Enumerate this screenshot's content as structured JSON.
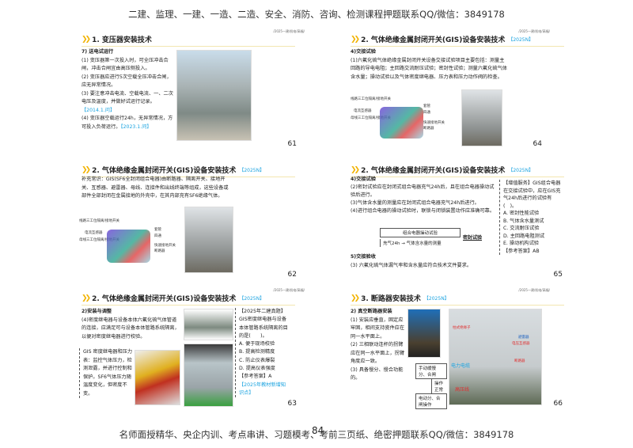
{
  "header": "二建、监理、一建、一造、二造、安全、消防、咨询、检测课程押题联系QQ/微信：3849178",
  "footer": "名师面授精华、央企内训、考点串讲、习题模考、考前三页纸、绝密押题联系QQ/微信：3849178",
  "page_number": "84",
  "crumb": "/2025一建/机电/高福/",
  "slides": [
    {
      "num": "61",
      "title": "1. 变压器安装技术",
      "heading": "7) 送电试运行",
      "lines": [
        "(1) 变压器第一次投入时，可全压冲击合闸，冲击合闸宜由高压侧投入。",
        "(2) 变压器应进行5次空载全压冲击合闸，应无异常情况。",
        "(3) 要注意冲击电流、空载电流、一、二次电压及温度，并做好试运行记录。"
      ],
      "tag1": "【2014.1.问】",
      "line4": "(4) 变压器空载运行24h，无异常情况，方可投入负荷运行。",
      "tag2": "【2023.1.问】"
    },
    {
      "num": "64",
      "title": "2. 气体绝缘金属封闭开关(GIS)设备安装技术",
      "tag": "【2025N】",
      "heading": "4)交接试验",
      "text": "(1)六氟化硫气体绝缘金属封闭开关设备交接试验项目主要包括：测量主回路的导电电阻；主回路交流耐压试验；密封性试验；测量六氟化硫气体含水量；操动试验以及气体密度继电器、压力表和压力动作阀的检查。",
      "labels": [
        "线路三工位隔离/接地开关",
        "电流互感器",
        "母线三工位隔离/接地开关",
        "套管",
        "四通",
        "快速接地开关",
        "断路器"
      ]
    },
    {
      "num": "62",
      "title": "2. 气体绝缘金属封闭开关(GIS)设备安装技术",
      "tag": "【2025N】",
      "text": "补充常识：GIS(SF6全封闭组合电器)由断路器、隔离开关、接地开关、互感器、避雷器、母线、连接件和出线终端等组成，这些设备或部件全部封闭在金属接地的外壳中，在其内部充有SF6绝缘气体。",
      "labels": [
        "线路三工位隔离/接地开关",
        "电流互感器",
        "母线三工位隔离/接地开关",
        "套管",
        "四通",
        "快速接地开关",
        "断路器"
      ]
    },
    {
      "num": "65",
      "title": "2. 气体绝缘金属封闭开关(GIS)设备安装技术",
      "tag": "【2025N】",
      "heading": "4)交接试验",
      "lines": [
        "(2)密封试验应在封闭式组合电器充气24h后，且在组合电器操动试验后进行。",
        "(3)气体含水量的测量应在封闭式组合电器充气24h后进行。",
        "(4)进行组合电器的操动试验时，联锁与闭锁装置动作应准确可靠。"
      ],
      "diagram": {
        "top": "组合电器操动试验",
        "bottom": "充气24h → 气体含水量的测量",
        "result": "密封试验"
      },
      "heading2": "5)交接验收",
      "line5": "(3) 六氟化硫气体漏气率和含水量应符合技术文件要求。",
      "question": "【增值服务】GIS组合电器在交接试验中，应在GIS充气24h后进行的试验有(　)。",
      "options": [
        "A. 密封性能试验",
        "B. 气体含水量测试",
        "C. 交流耐压试验",
        "D. 主回路电阻测试",
        "E. 操动机构试验"
      ],
      "answer": "【参考答案】AB"
    },
    {
      "num": "63",
      "title": "2. 气体绝缘金属封闭开关(GIS)设备安装技术",
      "tag": "【2025N】",
      "heading": "2)安装与调整",
      "text": "(4)密度继电器与设备本体六氟化硫气体管道的连接，应满足可与设备本体管路系统隔离，以便对密度继电器进行校验。",
      "note": "GIS 密度继电器和压力表：监控气体压力，检测泄露，并进行控制和保护。SF6气体压力随温度变化，但密度不变。",
      "question": "【2025年二建真题】GIS密度继电器与设备本体管路系统隔离的目的是(　　)。",
      "options": [
        "A. 便于现场校验",
        "B. 提高检测精度",
        "C. 防止仪表爆裂",
        "D. 提高仪表强度"
      ],
      "answer": "【参考答案】A",
      "tag2": "【2025年教材新增知识点】"
    },
    {
      "num": "66",
      "title": "3. 断路器安装技术",
      "tag": "【2025N】",
      "heading": "2) 真空断路器安装",
      "lines": [
        "(1) 安装应垂直，固定应牢固，相间支持瓷件应在同一水平面上。",
        "(2) 三相联动连杆的拐臂应在同一水平面上，拐臂角度应一致。",
        "(3) 具备慢分、慢合功能的。"
      ],
      "boxes": [
        "手动缓慢分、合闸",
        "操作正常",
        "电动分、合闸操作"
      ],
      "photo_labels": [
        "柱式绝缘子",
        "避雷器",
        "电压互感器",
        "电力电缆",
        "断路器",
        "高压线"
      ]
    }
  ]
}
